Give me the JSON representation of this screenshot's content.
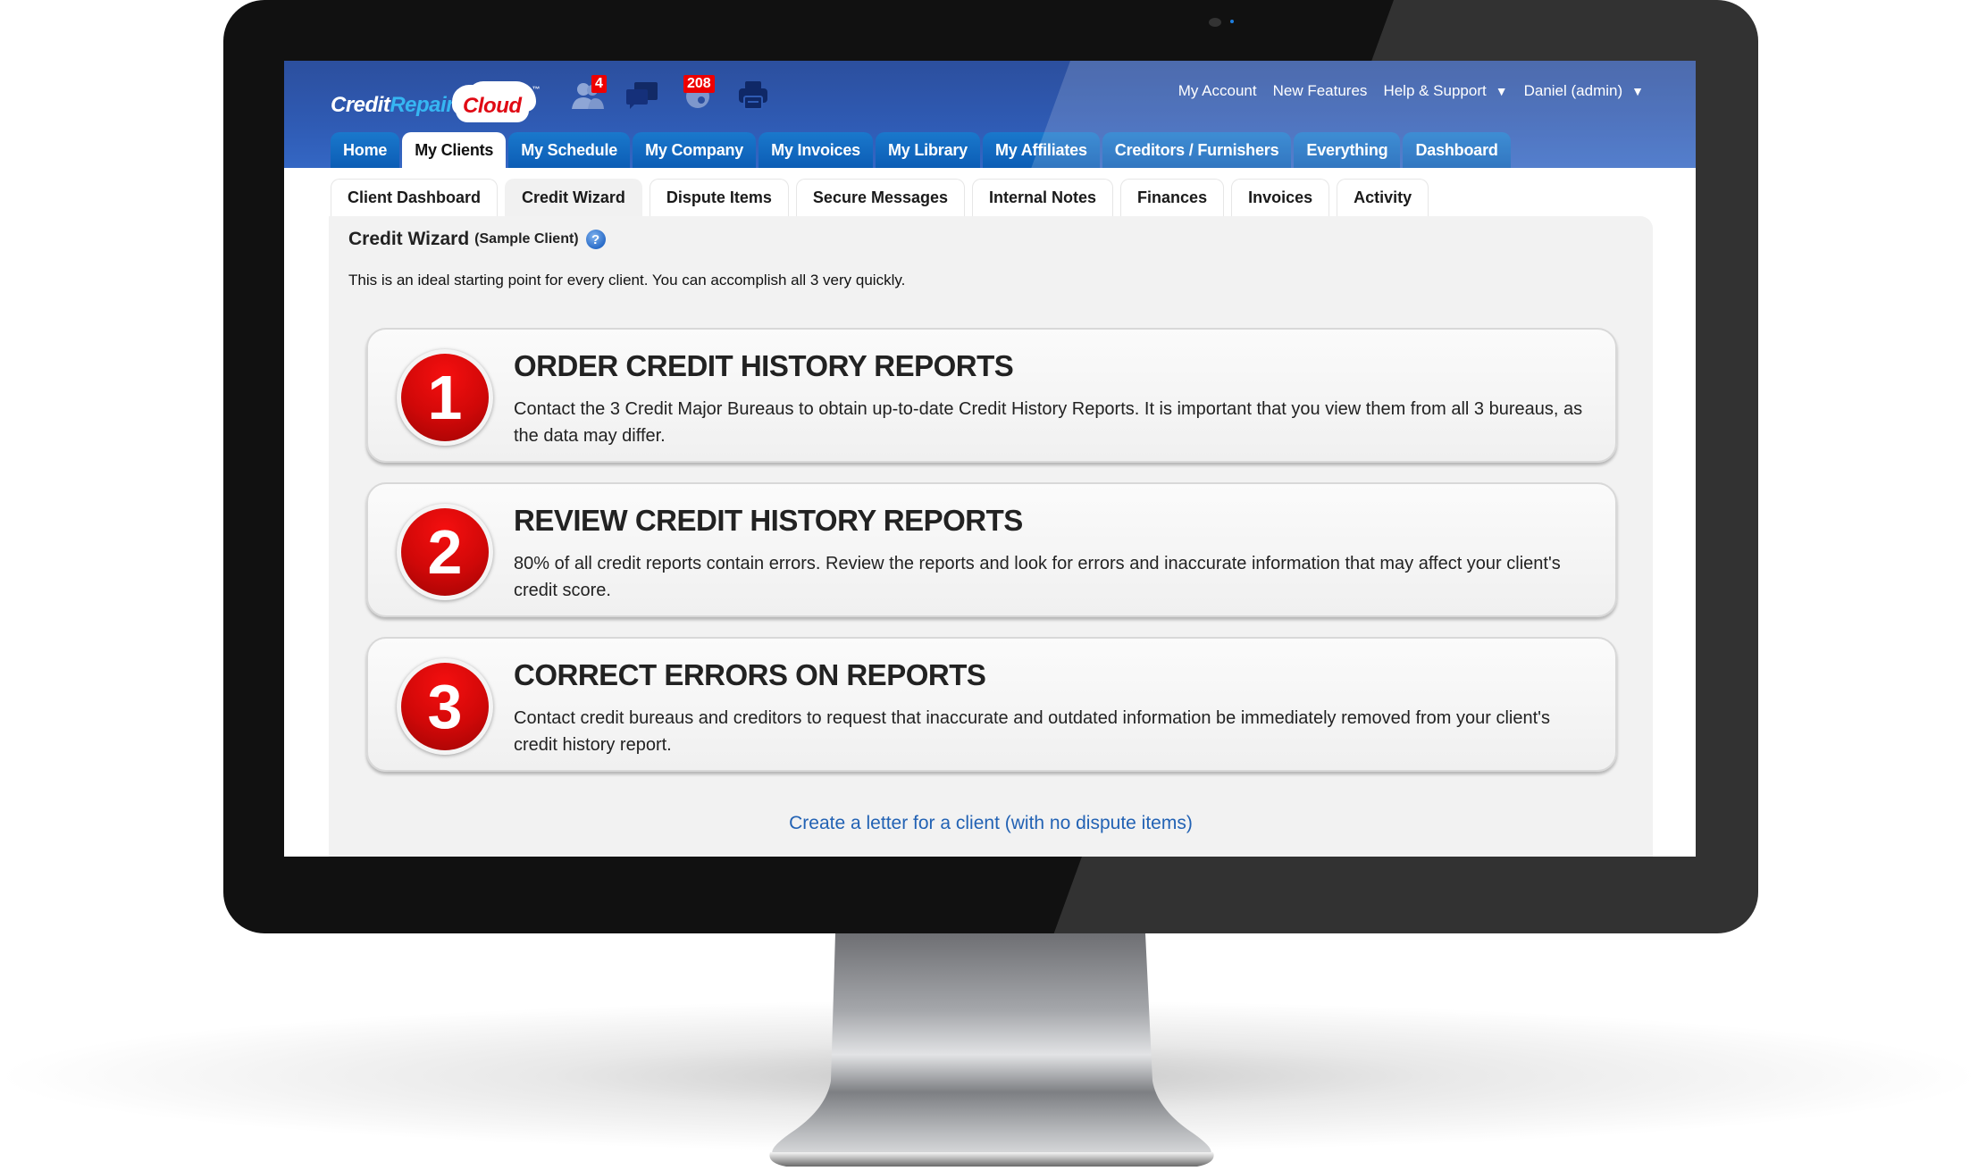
{
  "header": {
    "logo": {
      "part1": "Credit",
      "part2": "Repair",
      "part3": "Cloud",
      "tm": "™"
    },
    "icons": [
      {
        "name": "clients-icon",
        "badge": "4"
      },
      {
        "name": "messages-icon",
        "badge": ""
      },
      {
        "name": "notifications-icon",
        "badge": "208"
      },
      {
        "name": "printer-icon",
        "badge": ""
      }
    ],
    "links": {
      "my_account": "My Account",
      "new_features": "New Features",
      "help_support": "Help & Support",
      "user": "Daniel (admin)"
    },
    "caret": "▼"
  },
  "main_tabs": [
    {
      "label": "Home",
      "active": false
    },
    {
      "label": "My Clients",
      "active": true
    },
    {
      "label": "My Schedule",
      "active": false
    },
    {
      "label": "My Company",
      "active": false
    },
    {
      "label": "My Invoices",
      "active": false
    },
    {
      "label": "My Library",
      "active": false
    },
    {
      "label": "My Affiliates",
      "active": false
    },
    {
      "label": "Creditors / Furnishers",
      "active": false
    },
    {
      "label": "Everything",
      "active": false
    },
    {
      "label": "Dashboard",
      "active": false
    }
  ],
  "sub_tabs": [
    {
      "label": "Client Dashboard",
      "active": false
    },
    {
      "label": "Credit Wizard",
      "active": true
    },
    {
      "label": "Dispute Items",
      "active": false
    },
    {
      "label": "Secure Messages",
      "active": false
    },
    {
      "label": "Internal Notes",
      "active": false
    },
    {
      "label": "Finances",
      "active": false
    },
    {
      "label": "Invoices",
      "active": false
    },
    {
      "label": "Activity",
      "active": false
    }
  ],
  "page": {
    "title": "Credit Wizard",
    "client": "(Sample Client)",
    "help": "?",
    "description": "This is an ideal starting point for every client. You can accomplish all 3 very quickly."
  },
  "steps": [
    {
      "number": "1",
      "title": "ORDER CREDIT HISTORY REPORTS",
      "text": "Contact the 3 Credit Major Bureaus to obtain up-to-date Credit History Reports. It is important that you view them from all 3 bureaus, as the data may differ."
    },
    {
      "number": "2",
      "title": "REVIEW CREDIT HISTORY REPORTS",
      "text": "80% of all credit reports contain errors. Review the reports and look for errors and inaccurate information that may affect your client's credit score."
    },
    {
      "number": "3",
      "title": "CORRECT ERRORS ON REPORTS",
      "text": "Contact credit bureaus and creditors to request that inaccurate and outdated information be immediately removed from your client's credit history report."
    }
  ],
  "letter_link": "Create a letter for a client (with no dispute items)",
  "colors": {
    "header_blue": "#2f5bb4",
    "tab_blue": "#0c5db5",
    "badge_red": "#ee0000",
    "step_red": "#d00808",
    "link_blue": "#2262b4"
  }
}
